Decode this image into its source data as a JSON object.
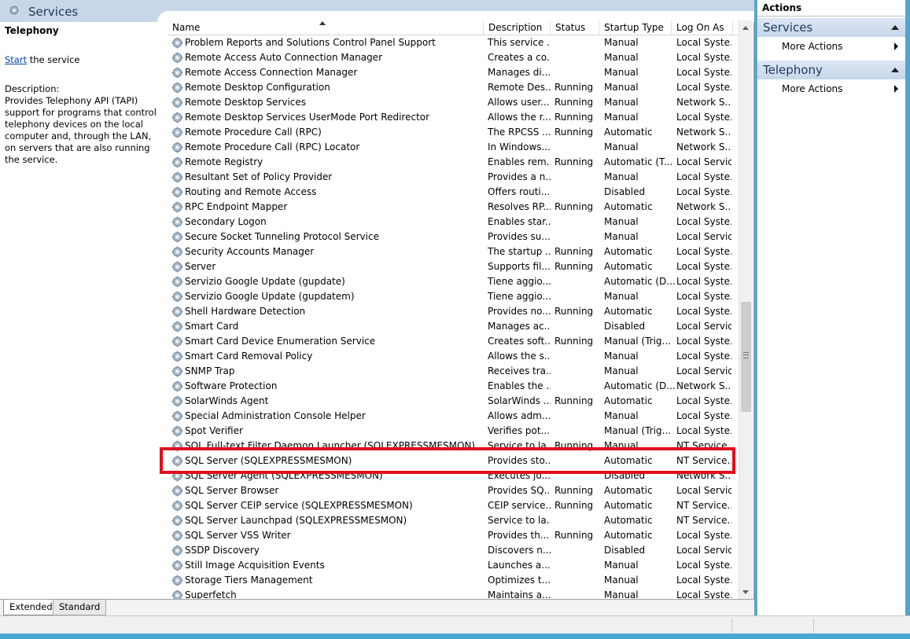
{
  "window": {
    "title": "Services"
  },
  "description_pane": {
    "service_name": "Telephony",
    "start_link": "Start",
    "start_suffix": " the service",
    "description_label": "Description:",
    "description_text": "Provides Telephony API (TAPI) support for programs that control telephony devices on the local computer and, through the LAN, on servers that are also running the service."
  },
  "columns": [
    "Name",
    "Description",
    "Status",
    "Startup Type",
    "Log On As"
  ],
  "rows": [
    {
      "name": "Problem Reports and Solutions Control Panel Support",
      "description": "This service ...",
      "status": "",
      "startup": "Manual",
      "logon": "Local Syste..."
    },
    {
      "name": "Remote Access Auto Connection Manager",
      "description": "Creates a co...",
      "status": "",
      "startup": "Manual",
      "logon": "Local Syste..."
    },
    {
      "name": "Remote Access Connection Manager",
      "description": "Manages di...",
      "status": "",
      "startup": "Manual",
      "logon": "Local Syste..."
    },
    {
      "name": "Remote Desktop Configuration",
      "description": "Remote Des...",
      "status": "Running",
      "startup": "Manual",
      "logon": "Local Syste..."
    },
    {
      "name": "Remote Desktop Services",
      "description": "Allows user...",
      "status": "Running",
      "startup": "Manual",
      "logon": "Network S..."
    },
    {
      "name": "Remote Desktop Services UserMode Port Redirector",
      "description": "Allows the r...",
      "status": "Running",
      "startup": "Manual",
      "logon": "Local Syste..."
    },
    {
      "name": "Remote Procedure Call (RPC)",
      "description": "The RPCSS ...",
      "status": "Running",
      "startup": "Automatic",
      "logon": "Network S..."
    },
    {
      "name": "Remote Procedure Call (RPC) Locator",
      "description": "In Windows...",
      "status": "",
      "startup": "Manual",
      "logon": "Network S..."
    },
    {
      "name": "Remote Registry",
      "description": "Enables rem...",
      "status": "Running",
      "startup": "Automatic (T...",
      "logon": "Local Service"
    },
    {
      "name": "Resultant Set of Policy Provider",
      "description": "Provides a n...",
      "status": "",
      "startup": "Manual",
      "logon": "Local Syste..."
    },
    {
      "name": "Routing and Remote Access",
      "description": "Offers routi...",
      "status": "",
      "startup": "Disabled",
      "logon": "Local Syste..."
    },
    {
      "name": "RPC Endpoint Mapper",
      "description": "Resolves RP...",
      "status": "Running",
      "startup": "Automatic",
      "logon": "Network S..."
    },
    {
      "name": "Secondary Logon",
      "description": "Enables star...",
      "status": "",
      "startup": "Manual",
      "logon": "Local Syste..."
    },
    {
      "name": "Secure Socket Tunneling Protocol Service",
      "description": "Provides su...",
      "status": "",
      "startup": "Manual",
      "logon": "Local Service"
    },
    {
      "name": "Security Accounts Manager",
      "description": "The startup ...",
      "status": "Running",
      "startup": "Automatic",
      "logon": "Local Syste..."
    },
    {
      "name": "Server",
      "description": "Supports fil...",
      "status": "Running",
      "startup": "Automatic",
      "logon": "Local Syste..."
    },
    {
      "name": "Servizio Google Update (gupdate)",
      "description": "Tiene aggio...",
      "status": "",
      "startup": "Automatic (D...",
      "logon": "Local Syste..."
    },
    {
      "name": "Servizio Google Update (gupdatem)",
      "description": "Tiene aggio...",
      "status": "",
      "startup": "Manual",
      "logon": "Local Syste..."
    },
    {
      "name": "Shell Hardware Detection",
      "description": "Provides no...",
      "status": "Running",
      "startup": "Automatic",
      "logon": "Local Syste..."
    },
    {
      "name": "Smart Card",
      "description": "Manages ac...",
      "status": "",
      "startup": "Disabled",
      "logon": "Local Service"
    },
    {
      "name": "Smart Card Device Enumeration Service",
      "description": "Creates soft...",
      "status": "Running",
      "startup": "Manual (Trig...",
      "logon": "Local Syste..."
    },
    {
      "name": "Smart Card Removal Policy",
      "description": "Allows the s...",
      "status": "",
      "startup": "Manual",
      "logon": "Local Syste..."
    },
    {
      "name": "SNMP Trap",
      "description": "Receives tra...",
      "status": "",
      "startup": "Manual",
      "logon": "Local Service"
    },
    {
      "name": "Software Protection",
      "description": "Enables the ...",
      "status": "",
      "startup": "Automatic (D...",
      "logon": "Network S..."
    },
    {
      "name": "SolarWinds Agent",
      "description": "SolarWinds ...",
      "status": "Running",
      "startup": "Automatic",
      "logon": "Local Syste..."
    },
    {
      "name": "Special Administration Console Helper",
      "description": "Allows adm...",
      "status": "",
      "startup": "Manual",
      "logon": "Local Syste..."
    },
    {
      "name": "Spot Verifier",
      "description": "Verifies pot...",
      "status": "",
      "startup": "Manual (Trig...",
      "logon": "Local Syste..."
    },
    {
      "name": "SQL Full-text Filter Daemon Launcher (SQLEXPRESSMESMON)",
      "description": "Service to la...",
      "status": "Running",
      "startup": "Manual",
      "logon": "NT Service..."
    },
    {
      "name": "SQL Server (SQLEXPRESSMESMON)",
      "description": "Provides sto...",
      "status": "",
      "startup": "Automatic",
      "logon": "NT Service..."
    },
    {
      "name": "SQL Server Agent (SQLEXPRESSMESMON)",
      "description": "Executes jo...",
      "status": "",
      "startup": "Disabled",
      "logon": "Network S..."
    },
    {
      "name": "SQL Server Browser",
      "description": "Provides SQ...",
      "status": "Running",
      "startup": "Automatic",
      "logon": "Local Service"
    },
    {
      "name": "SQL Server CEIP service (SQLEXPRESSMESMON)",
      "description": "CEIP service...",
      "status": "Running",
      "startup": "Automatic",
      "logon": "NT Service..."
    },
    {
      "name": "SQL Server Launchpad (SQLEXPRESSMESMON)",
      "description": "Service to la...",
      "status": "",
      "startup": "Automatic",
      "logon": "NT Service..."
    },
    {
      "name": "SQL Server VSS Writer",
      "description": "Provides th...",
      "status": "Running",
      "startup": "Automatic",
      "logon": "Local Syste..."
    },
    {
      "name": "SSDP Discovery",
      "description": "Discovers n...",
      "status": "",
      "startup": "Disabled",
      "logon": "Local Service"
    },
    {
      "name": "Still Image Acquisition Events",
      "description": "Launches a...",
      "status": "",
      "startup": "Manual",
      "logon": "Local Syste..."
    },
    {
      "name": "Storage Tiers Management",
      "description": "Optimizes t...",
      "status": "",
      "startup": "Manual",
      "logon": "Local Syste..."
    },
    {
      "name": "Superfetch",
      "description": "Maintains a...",
      "status": "",
      "startup": "Manual",
      "logon": "Local Syste..."
    }
  ],
  "highlighted_row": "SQL Server (SQLEXPRESSMESMON)",
  "bottom_tabs": {
    "extended": "Extended",
    "standard": "Standard",
    "active": "Extended"
  },
  "actions_pane": {
    "title": "Actions",
    "groups": [
      {
        "label": "Services",
        "items": [
          "More Actions"
        ]
      },
      {
        "label": "Telephony",
        "items": [
          "More Actions"
        ]
      }
    ]
  },
  "colors": {
    "highlight_border": "#e0101e",
    "title_band": "#c8d7e8",
    "desktop": "#4aa8d6"
  },
  "icons": {
    "service_row": "gear-icon",
    "title": "gear-icon"
  }
}
